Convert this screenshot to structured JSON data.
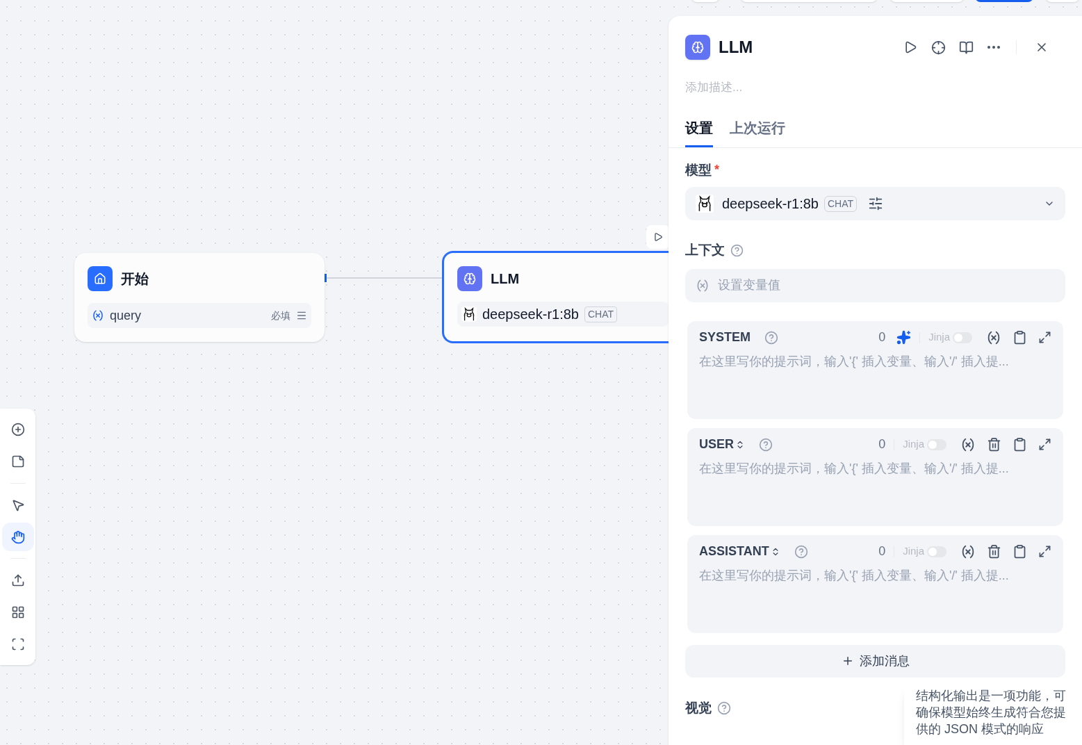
{
  "canvas": {
    "start_node": {
      "title": "开始",
      "variables": [
        {
          "name": "query",
          "required_label": "必填"
        }
      ]
    },
    "llm_node": {
      "title": "LLM",
      "model": "deepseek-r1:8b",
      "model_tag": "CHAT",
      "selected": true
    }
  },
  "toolbar": {
    "groups": [
      [
        {
          "kind": "add"
        },
        {
          "kind": "note"
        }
      ],
      [
        {
          "kind": "pointer",
          "selected": false
        },
        {
          "kind": "hand",
          "selected": true
        }
      ],
      [
        {
          "kind": "export"
        },
        {
          "kind": "organize"
        },
        {
          "kind": "fit"
        }
      ]
    ]
  },
  "panel": {
    "title": "LLM",
    "description_placeholder": "添加描述...",
    "tabs": [
      {
        "label": "设置",
        "selected": true
      },
      {
        "label": "上次运行",
        "selected": false
      }
    ],
    "model_label": "模型",
    "model_required": "*",
    "model": {
      "name": "deepseek-r1:8b",
      "tag": "CHAT"
    },
    "context_label": "上下文",
    "context_placeholder": "设置变量值",
    "messages": [
      {
        "kind": "system",
        "role": "SYSTEM",
        "count": "0",
        "jinja_label": "Jinja",
        "jinja_on": false,
        "placeholder": "在这里写你的提示词，输入'{' 插入变量、输入'/' 插入提..."
      },
      {
        "kind": "editable",
        "role": "USER",
        "count": "0",
        "jinja_label": "Jinja",
        "jinja_on": false,
        "placeholder": "在这里写你的提示词，输入'{' 插入变量、输入'/' 插入提..."
      },
      {
        "kind": "editable",
        "role": "ASSISTANT",
        "count": "0",
        "jinja_label": "Jinja",
        "jinja_on": false,
        "placeholder": "在这里写你的提示词，输入'{' 插入变量、输入'/' 插入提..."
      }
    ],
    "add_message_label": "添加消息",
    "vision_label": "视觉",
    "tooltip": "结构化输出是一项功能，可确保模型始终生成符合您提供的 JSON 模式的响应"
  }
}
